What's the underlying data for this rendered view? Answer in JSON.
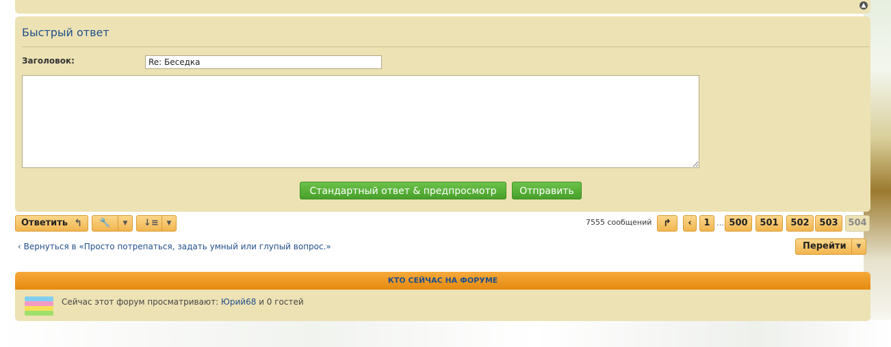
{
  "quick_reply": {
    "title": "Быстрый ответ",
    "subject_label": "Заголовок:",
    "subject_value": "Re: Беседка",
    "message_value": "",
    "preview_button": "Стандартный ответ & предпросмотр",
    "send_button": "Отправить"
  },
  "toolbar": {
    "reply_button": "Ответить",
    "posts_count": "7555 сообщений",
    "pages": {
      "first": "1",
      "dots": "…",
      "p500": "500",
      "p501": "501",
      "p502": "502",
      "p503": "503",
      "current": "504"
    }
  },
  "navigation": {
    "back_link": "Вернуться в «Просто потрепаться, задать умный или глупый вопрос.»",
    "jump_button": "Перейти"
  },
  "online": {
    "header": "КТО СЕЙЧАС НА ФОРУМЕ",
    "text_prefix": "Сейчас этот форум просматривают: ",
    "user": "Юрий68",
    "text_suffix": " и 0 гостей"
  },
  "icons": {
    "reply": "reply-arrow-icon",
    "tools": "wrench-icon",
    "sort": "sort-icon",
    "jump": "jump-to-page-icon",
    "prev": "chevron-left-icon",
    "back": "chevron-left-icon",
    "scroll_top": "chevron-up-icon",
    "online": "book-stack-icon"
  },
  "colors": {
    "panel": "#ede2b4",
    "accent_orange": "#f1b54f",
    "button_green": "#47a02a",
    "link_blue": "#1f4e8a"
  }
}
